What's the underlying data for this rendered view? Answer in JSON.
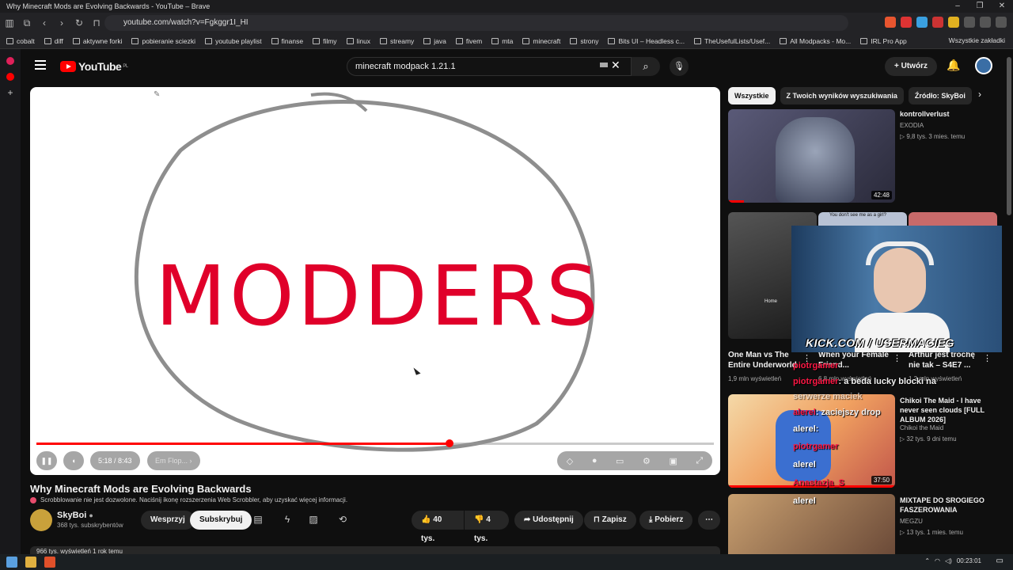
{
  "window": {
    "title": "Why Minecraft Mods are Evolving Backwards - YouTube – Brave"
  },
  "browser": {
    "url": "youtube.com/watch?v=Fgkggr1I_HI",
    "bookmarks": [
      "cobalt",
      "diff",
      "aktywne forki",
      "pobieranie sciezki",
      "youtube playlist",
      "finanse",
      "filmy",
      "linux",
      "streamy",
      "java",
      "fivem",
      "mta",
      "minecraft",
      "strony",
      "Bits UI – Headless c...",
      "TheUsefulLists/Usef...",
      "All Modpacks - Mo...",
      "IRL Pro App"
    ],
    "all_bookmarks": "Wszystkie zakładki"
  },
  "youtube": {
    "logo": "YouTube",
    "region": "PL",
    "search_query": "minecraft modpack 1.21.1",
    "create_label": "Utwórz"
  },
  "player": {
    "drawing_text": "MODDERS",
    "time": "5:18 / 8:43",
    "chapter": "Em Flop...",
    "progress": 0.61
  },
  "video": {
    "title": "Why Minecraft Mods are Evolving Backwards",
    "scrobbler_notice": "Scrobblowanie nie jest dozwolone. Naciśnij ikonę rozszerzenia Web Scrobbler, aby uzyskać więcej informacji.",
    "channel": "SkyBoi",
    "subscribers": "368 tys. subskrybentów",
    "support_label": "Wesprzyj",
    "subscribe_label": "Subskrybuj",
    "likes": "40 tys.",
    "dislikes": "4 tys.",
    "share_label": "Udostępnij",
    "save_label": "Zapisz",
    "download_label": "Pobierz",
    "views": "966 tys. wyświetleń  1 rok temu"
  },
  "sidebar": {
    "chips": [
      "Wszystkie",
      "Z Twoich wyników wyszukiwania",
      "Źródło: SkyBoi"
    ],
    "recos": [
      {
        "title": "kontrollverlust",
        "channel": "EXODIA",
        "meta": "▷ 9,8 tys.  3 mies. temu",
        "duration": "42:48"
      },
      {
        "title": "Chikoi The Maid - I have never seen clouds [FULL ALBUM 2026]",
        "channel": "Chikoi the Maid",
        "meta": "▷ 32 tys.  9 dni temu",
        "duration": "37:50"
      },
      {
        "title": "MIXTAPE DO SROGIEGO FASZEROWANIA",
        "channel": "MEGZU",
        "meta": "▷ 13 tys.  1 mies. temu",
        "duration": ""
      }
    ],
    "shorts": [
      {
        "title": "One Man vs The Entire Underworld",
        "meta": "1,9 mln wyświetleń"
      },
      {
        "title": "When your Female Friend...",
        "meta": "6,8 mln wyświetleń"
      },
      {
        "title": "Arthur jest trochę nie tak – S4E7 ...",
        "meta": "1,2 mln wyświetleń"
      }
    ],
    "shorts_overlay_text": "You don't see me as a girl?",
    "shorts_thumb_text": "Home"
  },
  "stream_overlay": {
    "kick": "KICK.COM / USERMACIEG",
    "chat": [
      {
        "user": "piotrgamer",
        "msg": ""
      },
      {
        "user": "piotrgamer",
        "msg": ": a beda lucky blocki na"
      },
      {
        "user": "",
        "msg": "serwerze maciek"
      },
      {
        "user": "alerel",
        "msg": ": zaciejszy drop"
      },
      {
        "user": "alerel",
        "msg": ":"
      },
      {
        "user": "piotrgamer",
        "msg": ""
      },
      {
        "user": "alerel",
        "msg": ""
      },
      {
        "user": "Anastazja_S",
        "msg": ""
      },
      {
        "user": "alerel",
        "msg": ""
      }
    ]
  },
  "taskbar": {
    "time": "00:23:01"
  },
  "colors": {
    "yt_red": "#ff0000",
    "marker_red": "#e00030",
    "bg": "#0f0f0f"
  }
}
